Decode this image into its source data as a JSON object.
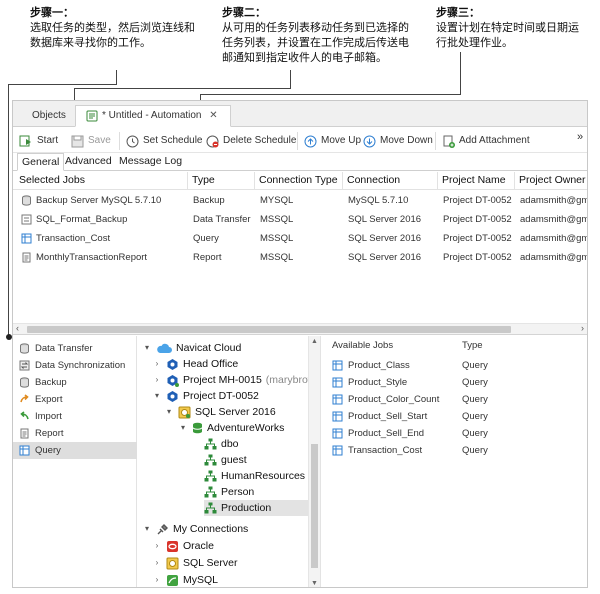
{
  "annotations": [
    {
      "title": "步骤一：",
      "text": "选取任务的类型，然后浏览连线和数据库来寻找你的工作。"
    },
    {
      "title": "步骤二：",
      "text": "从可用的任务列表移动任务到已选择的任务列表，并设置在工作完成后传送电邮通知到指定收件人的电子邮箱。"
    },
    {
      "title": "步骤三：",
      "text": "设置计划在特定时间或日期运行批处理作业。"
    }
  ],
  "tabs": [
    {
      "label": "Objects"
    },
    {
      "label": "* Untitled - Automation"
    }
  ],
  "toolbar": {
    "start": "Start",
    "save": "Save",
    "set_schedule": "Set Schedule",
    "delete_schedule": "Delete Schedule",
    "move_up": "Move Up",
    "move_down": "Move Down",
    "add_attachment": "Add Attachment",
    "overflow": "»"
  },
  "subtabs": [
    "General",
    "Advanced",
    "Message Log"
  ],
  "selected_jobs": {
    "columns": [
      "Selected Jobs",
      "Type",
      "Connection Type",
      "Connection",
      "Project Name",
      "Project Owner N"
    ],
    "rows": [
      {
        "job": "Backup Server MySQL 5.7.10",
        "type": "Backup",
        "conn_type": "MYSQL",
        "connection": "MySQL 5.7.10",
        "project": "Project DT-0052",
        "owner": "adamsmith@gma"
      },
      {
        "job": "SQL_Format_Backup",
        "type": "Data Transfer",
        "conn_type": "MSSQL",
        "connection": "SQL Server 2016",
        "project": "Project DT-0052",
        "owner": "adamsmith@gma"
      },
      {
        "job": "Transaction_Cost",
        "type": "Query",
        "conn_type": "MSSQL",
        "connection": "SQL Server 2016",
        "project": "Project DT-0052",
        "owner": "adamsmith@gma"
      },
      {
        "job": "MonthlyTransactionReport",
        "type": "Report",
        "conn_type": "MSSQL",
        "connection": "SQL Server 2016",
        "project": "Project DT-0052",
        "owner": "adamsmith@gma"
      }
    ]
  },
  "job_types": [
    {
      "label": "Data Transfer",
      "icon": "data-transfer-icon"
    },
    {
      "label": "Data Synchronization",
      "icon": "data-sync-icon"
    },
    {
      "label": "Backup",
      "icon": "backup-icon"
    },
    {
      "label": "Export",
      "icon": "export-icon"
    },
    {
      "label": "Import",
      "icon": "import-icon"
    },
    {
      "label": "Report",
      "icon": "report-icon"
    },
    {
      "label": "Query",
      "icon": "query-icon",
      "selected": true
    }
  ],
  "tree": {
    "navicat_cloud": "Navicat Cloud",
    "head_office": "Head Office",
    "project_mh": "Project MH-0015",
    "project_mh_owner": "(marybrow",
    "project_dt": "Project DT-0052",
    "sql_server": "SQL Server 2016",
    "adventureworks": "AdventureWorks",
    "dbo": "dbo",
    "guest": "guest",
    "human_resources": "HumanResources",
    "person": "Person",
    "production": "Production",
    "my_connections": "My Connections",
    "oracle": "Oracle",
    "sql_server_conn": "SQL Server",
    "mysql": "MySQL"
  },
  "available_jobs": {
    "header_job": "Available Jobs",
    "header_type": "Type",
    "rows": [
      {
        "job": "Product_Class",
        "type": "Query"
      },
      {
        "job": "Product_Style",
        "type": "Query"
      },
      {
        "job": "Product_Color_Count",
        "type": "Query"
      },
      {
        "job": "Product_Sell_Start",
        "type": "Query"
      },
      {
        "job": "Product_Sell_End",
        "type": "Query"
      },
      {
        "job": "Transaction_Cost",
        "type": "Query"
      }
    ]
  },
  "colors": {
    "accent_blue": "#2f7fd1",
    "folder_yellow": "#e8b422",
    "schema_green": "#2d8a3a",
    "oracle_red": "#d9342b",
    "mysql_green": "#41a340"
  }
}
